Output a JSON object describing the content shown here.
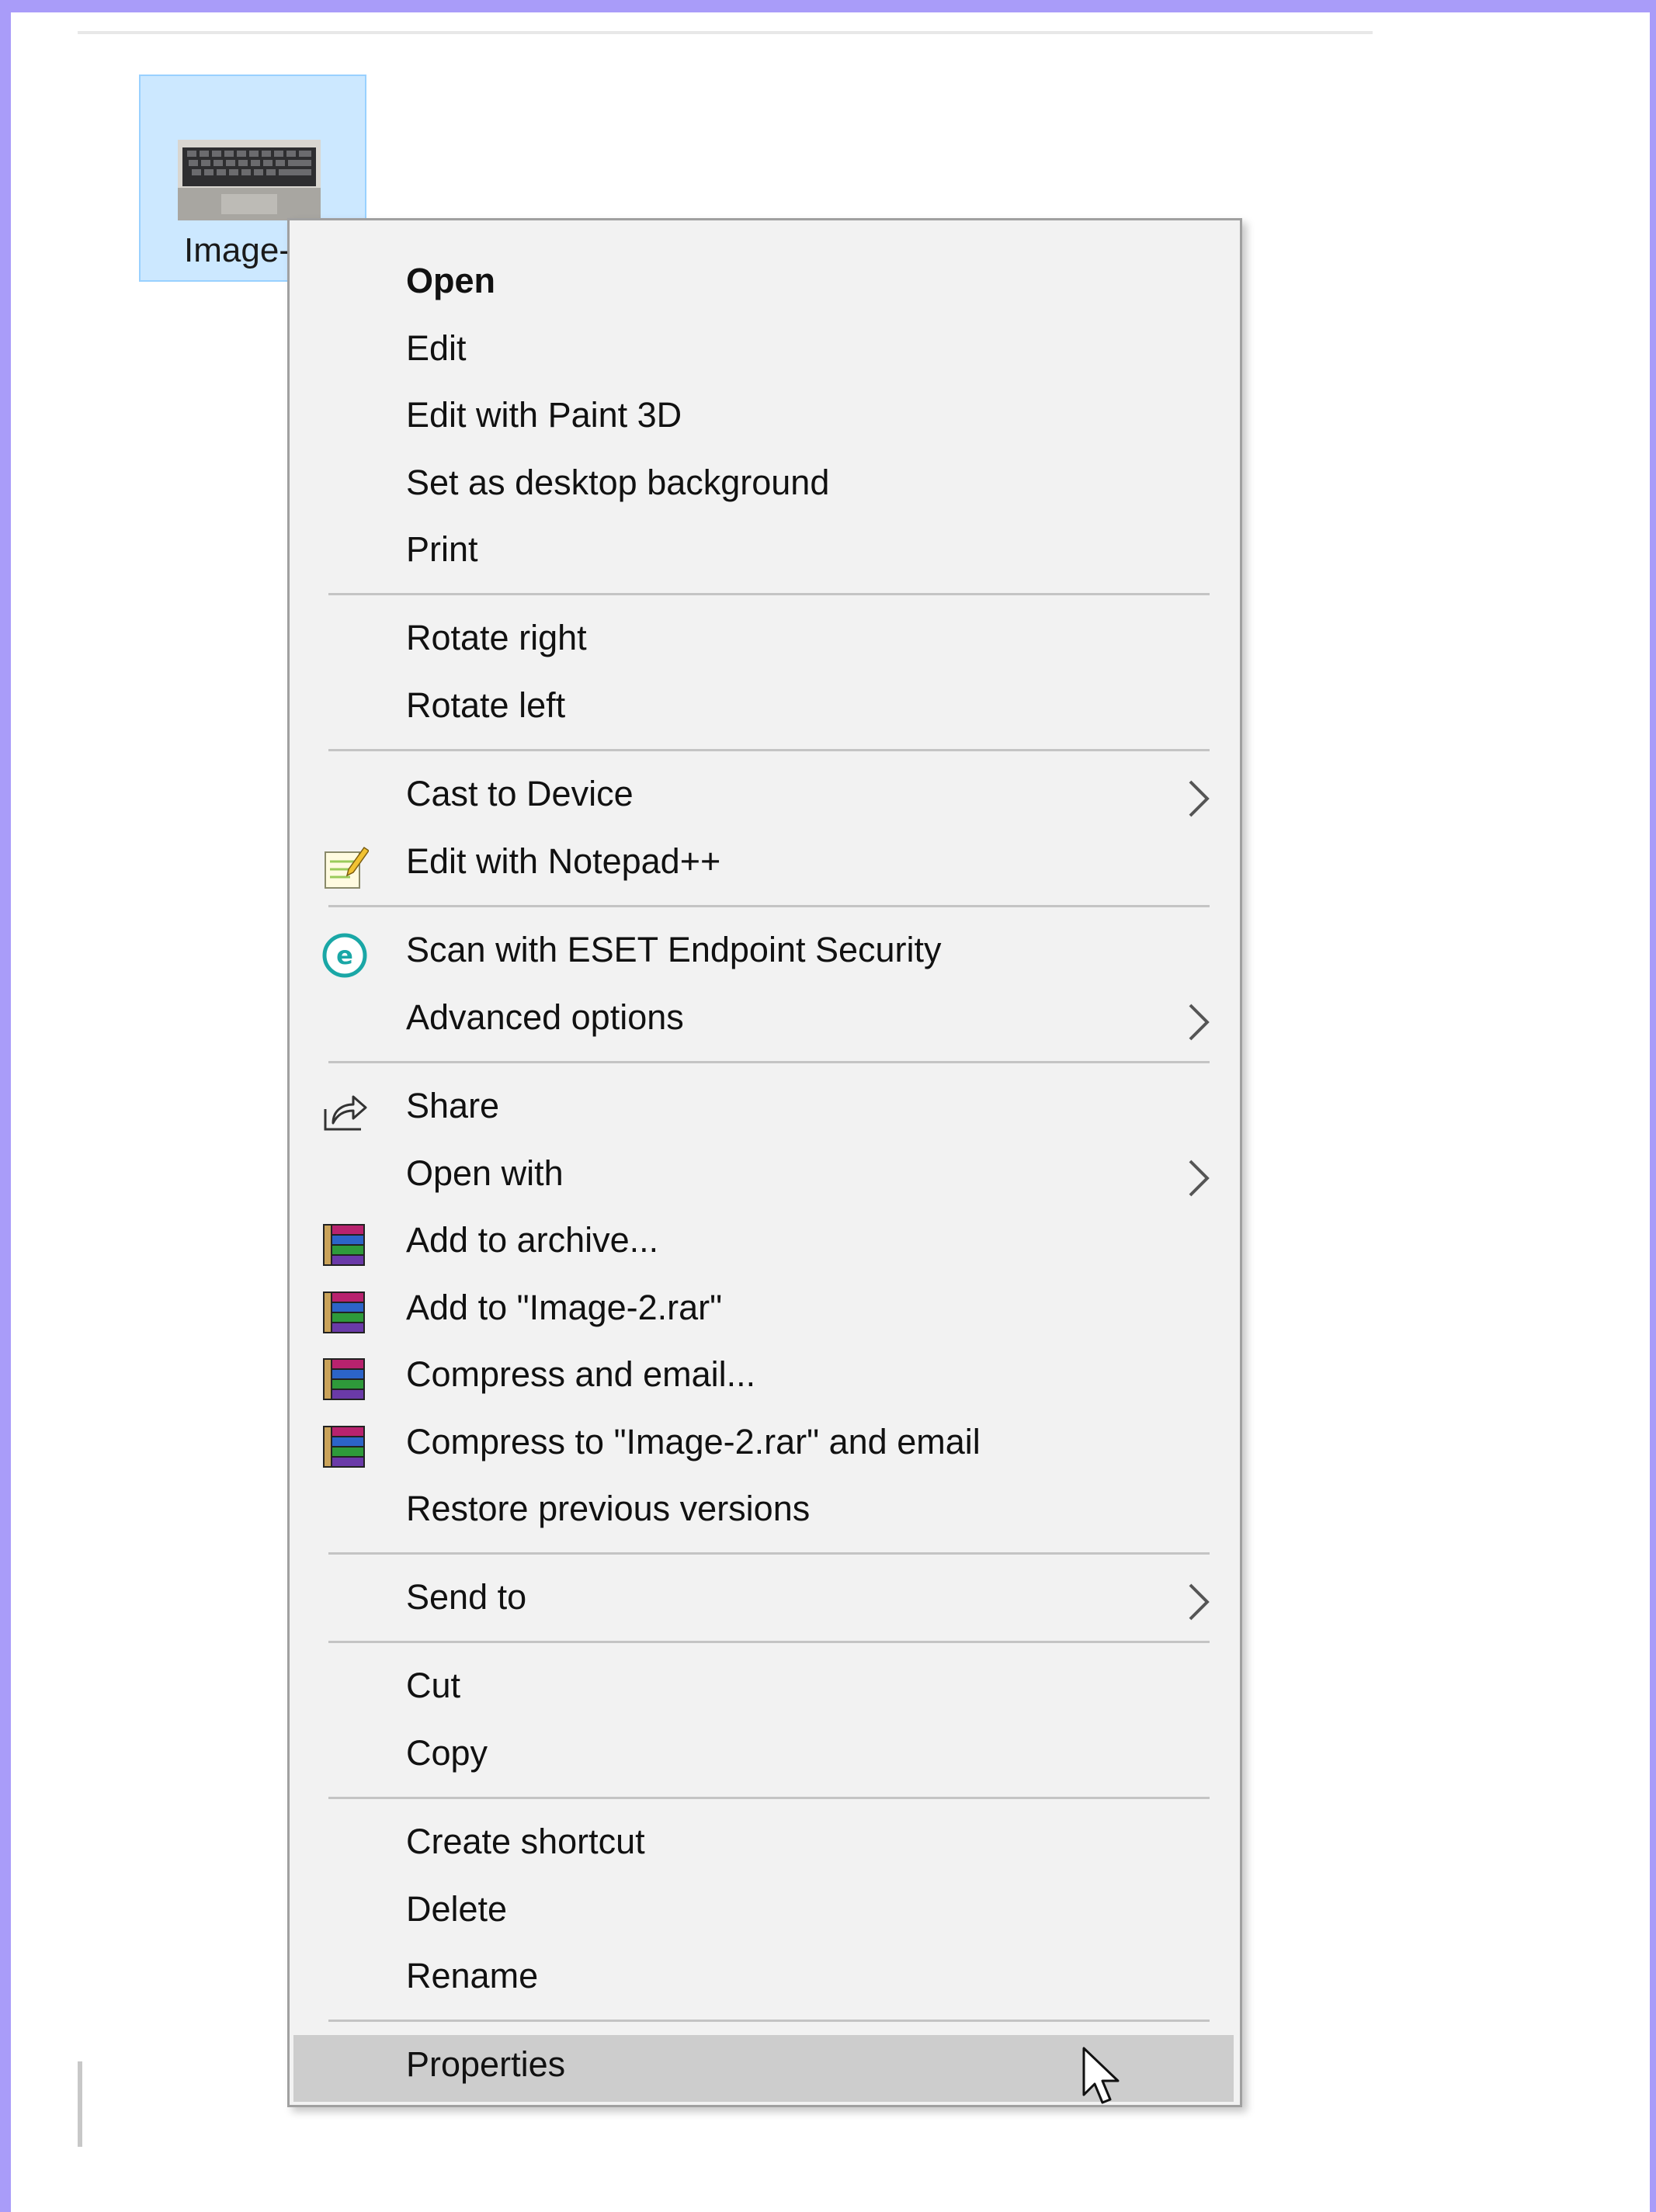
{
  "desktop": {
    "file_label": "Image-"
  },
  "context_menu": {
    "items": [
      {
        "label": "Open"
      },
      {
        "label": "Edit"
      },
      {
        "label": "Edit with Paint 3D"
      },
      {
        "label": "Set as desktop background"
      },
      {
        "label": "Print"
      },
      {
        "label": "Rotate right"
      },
      {
        "label": "Rotate left"
      },
      {
        "label": "Cast to Device"
      },
      {
        "label": "Edit with Notepad++"
      },
      {
        "label": "Scan with ESET Endpoint Security"
      },
      {
        "label": "Advanced options"
      },
      {
        "label": "Share"
      },
      {
        "label": "Open with"
      },
      {
        "label": "Add to archive..."
      },
      {
        "label": "Add to \"Image-2.rar\""
      },
      {
        "label": "Compress and email..."
      },
      {
        "label": "Compress to \"Image-2.rar\" and email"
      },
      {
        "label": "Restore previous versions"
      },
      {
        "label": "Send to"
      },
      {
        "label": "Cut"
      },
      {
        "label": "Copy"
      },
      {
        "label": "Create shortcut"
      },
      {
        "label": "Delete"
      },
      {
        "label": "Rename"
      },
      {
        "label": "Properties"
      }
    ],
    "highlighted_item": "Properties"
  },
  "colors": {
    "frame": "#a99cf9",
    "menu_background": "#f2f2f2",
    "menu_hover": "#cdcdcd",
    "selection": "#cce8ff"
  }
}
